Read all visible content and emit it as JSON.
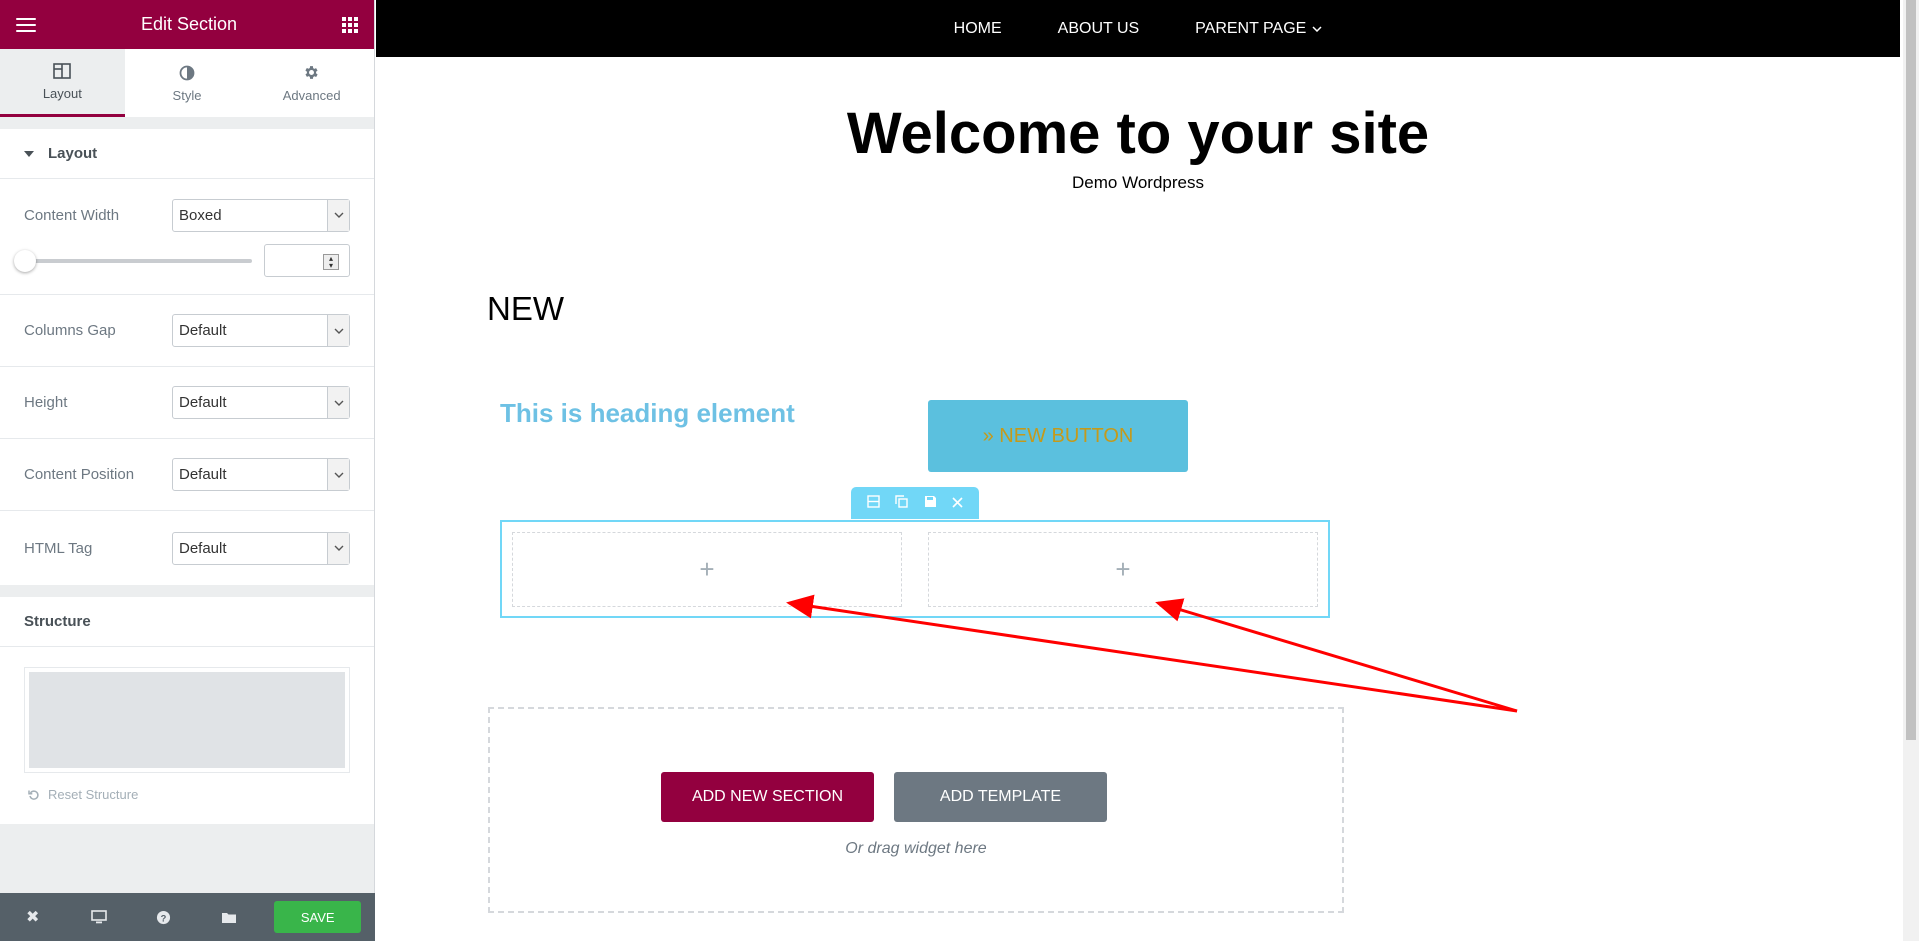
{
  "panel": {
    "title": "Edit Section",
    "tabs": [
      {
        "label": "Layout",
        "icon": "layout-icon"
      },
      {
        "label": "Style",
        "icon": "contrast-icon"
      },
      {
        "label": "Advanced",
        "icon": "gear-icon"
      }
    ],
    "layout_section": "Layout",
    "controls": {
      "content_width": {
        "label": "Content Width",
        "value": "Boxed"
      },
      "columns_gap": {
        "label": "Columns Gap",
        "value": "Default"
      },
      "height": {
        "label": "Height",
        "value": "Default"
      },
      "content_position": {
        "label": "Content Position",
        "value": "Default"
      },
      "html_tag": {
        "label": "HTML Tag",
        "value": "Default"
      }
    },
    "slider_value": "",
    "structure": {
      "title": "Structure",
      "reset": "Reset Structure"
    },
    "footer": {
      "save": "SAVE"
    }
  },
  "nav": {
    "items": [
      "HOME",
      "ABOUT US",
      "PARENT PAGE"
    ]
  },
  "site": {
    "title": "Welcome to your site",
    "tagline": "Demo Wordpress"
  },
  "content": {
    "new_heading": "NEW",
    "heading_element": "This is heading element",
    "button": "» NEW BUTTON",
    "column_plus": "+"
  },
  "add_area": {
    "add_section": "ADD NEW SECTION",
    "add_template": "ADD TEMPLATE",
    "drag_text": "Or drag widget here"
  },
  "colors": {
    "brand": "#93003f",
    "accent": "#71d7f7",
    "save": "#39b54a",
    "annotation_arrow": "#ff0000"
  }
}
